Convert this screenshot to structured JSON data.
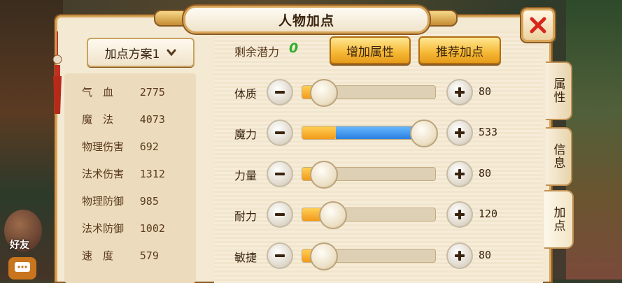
{
  "window": {
    "title": "人物加点"
  },
  "background": {
    "friend_label": "好友"
  },
  "plan": {
    "selected": "加点方案1"
  },
  "stats": [
    {
      "label": "气　血",
      "value": "2775",
      "spread": true
    },
    {
      "label": "魔　法",
      "value": "4073",
      "spread": true
    },
    {
      "label": "物理伤害",
      "value": "692",
      "spread": false
    },
    {
      "label": "法术伤害",
      "value": "1312",
      "spread": false
    },
    {
      "label": "物理防御",
      "value": "985",
      "spread": false
    },
    {
      "label": "法术防御",
      "value": "1002",
      "spread": false
    },
    {
      "label": "速　度",
      "value": "579",
      "spread": true
    }
  ],
  "potential": {
    "label": "剩余潜力",
    "value": "0"
  },
  "buttons": {
    "add_attr": "增加属性",
    "recommend": "推荐加点"
  },
  "attributes": [
    {
      "label": "体质",
      "value": "80",
      "fill_ratio": 0.15
    },
    {
      "label": "魔力",
      "value": "533",
      "fill_ratio": 1.0,
      "base_ratio": 0.25
    },
    {
      "label": "力量",
      "value": "80",
      "fill_ratio": 0.15
    },
    {
      "label": "耐力",
      "value": "120",
      "fill_ratio": 0.22
    },
    {
      "label": "敏捷",
      "value": "80",
      "fill_ratio": 0.15
    }
  ],
  "tabs": [
    {
      "label": "属性",
      "active": false
    },
    {
      "label": "信息",
      "active": false
    },
    {
      "label": "加点",
      "active": true
    }
  ],
  "colors": {
    "accent_gold": "#f5b834",
    "potential_green": "#2fae2f",
    "blue_fill": "#2a7fe0",
    "orange_fill": "#f29a1a",
    "close_red": "#d8261c"
  }
}
